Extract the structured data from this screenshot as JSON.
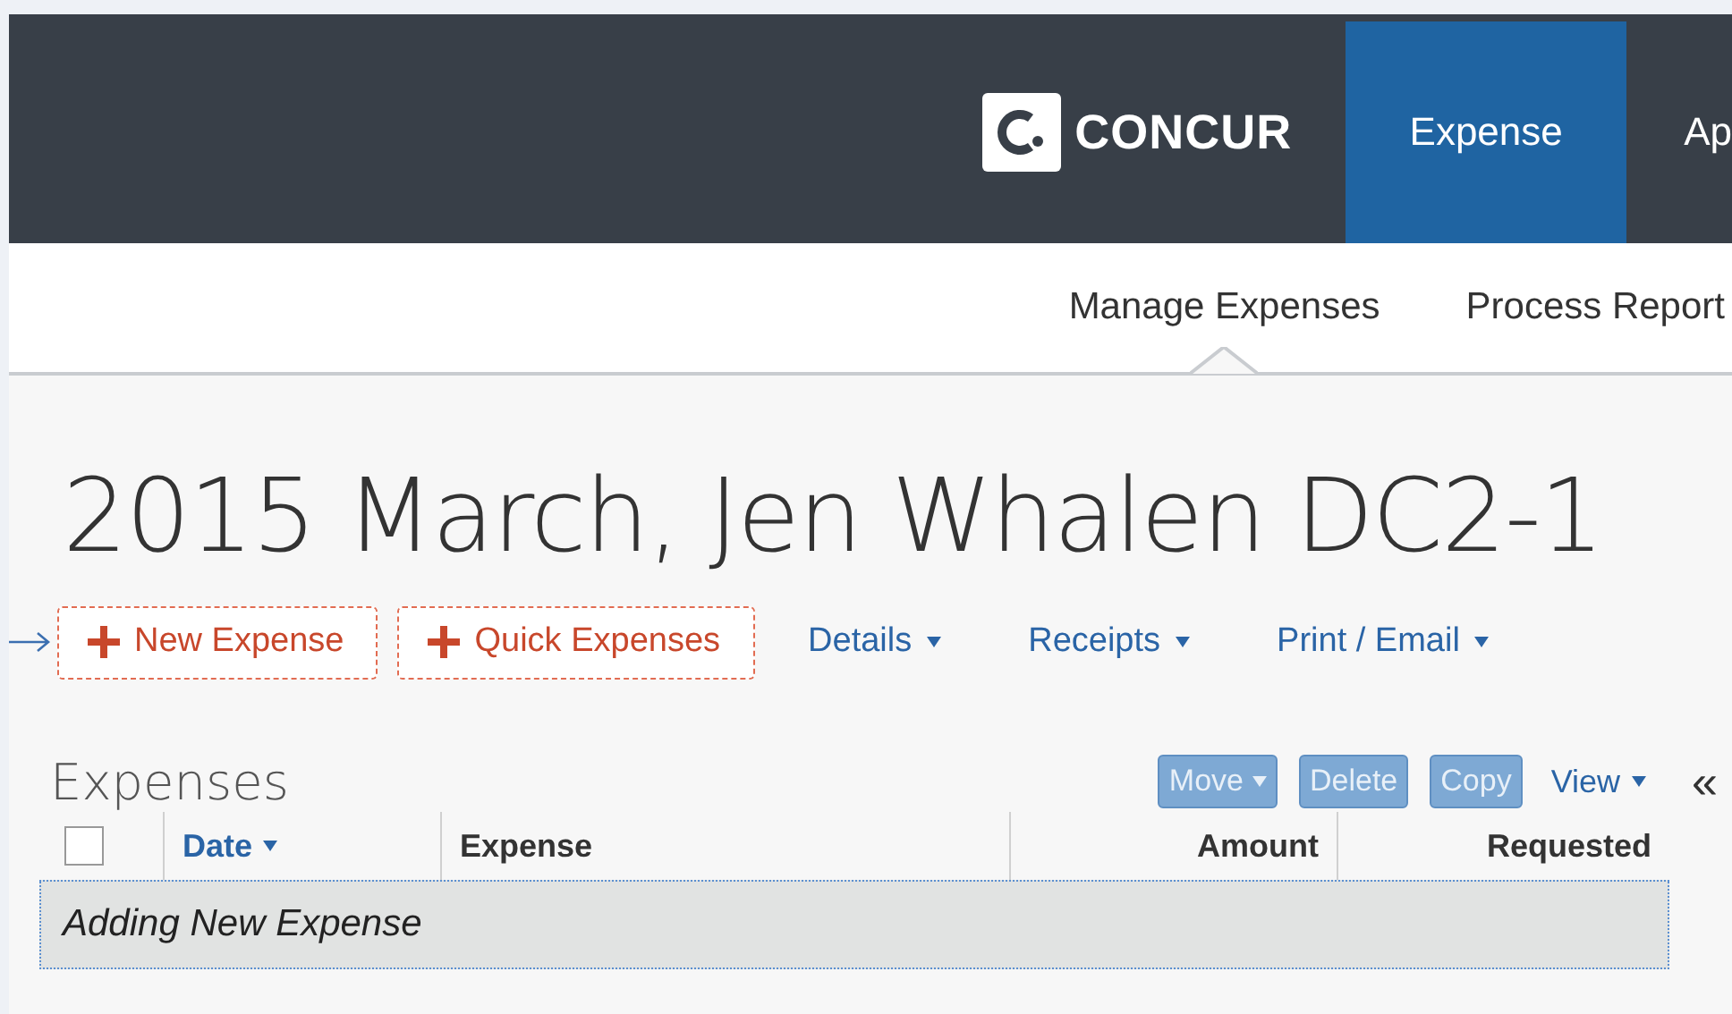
{
  "header": {
    "logo": "CONCUR",
    "tabs": [
      {
        "label": "Expense",
        "selected": true
      },
      {
        "label": "Ap",
        "selected": false
      }
    ]
  },
  "subnav": [
    {
      "label": "Manage Expenses",
      "selected": true
    },
    {
      "label": "Process Report",
      "selected": false
    }
  ],
  "report_title": "2015 March, Jen Whalen DC2-1",
  "actions": [
    {
      "kind": "add",
      "label": "New Expense"
    },
    {
      "kind": "add",
      "label": "Quick Expenses"
    },
    {
      "kind": "menu",
      "label": "Details"
    },
    {
      "kind": "menu",
      "label": "Receipts"
    },
    {
      "kind": "menu",
      "label": "Print / Email"
    }
  ],
  "expenses": {
    "title": "Expenses",
    "tools": [
      {
        "kind": "button",
        "label": "Move",
        "disabled": true,
        "caret": true
      },
      {
        "kind": "button",
        "label": "Delete",
        "disabled": true,
        "caret": false
      },
      {
        "kind": "button",
        "label": "Copy",
        "disabled": true,
        "caret": false
      },
      {
        "kind": "menu",
        "label": "View",
        "disabled": false,
        "caret": true
      }
    ],
    "collapse": "«",
    "table": {
      "select_all": {
        "checked": false
      },
      "columns": [
        {
          "label": "Date",
          "sorted": true,
          "numeric": false
        },
        {
          "label": "Expense",
          "sorted": false,
          "numeric": false
        },
        {
          "label": "Amount",
          "sorted": false,
          "numeric": true
        },
        {
          "label": "Requested",
          "sorted": false,
          "numeric": true
        }
      ],
      "rows": [
        {
          "text": "Adding New Expense"
        }
      ]
    }
  }
}
